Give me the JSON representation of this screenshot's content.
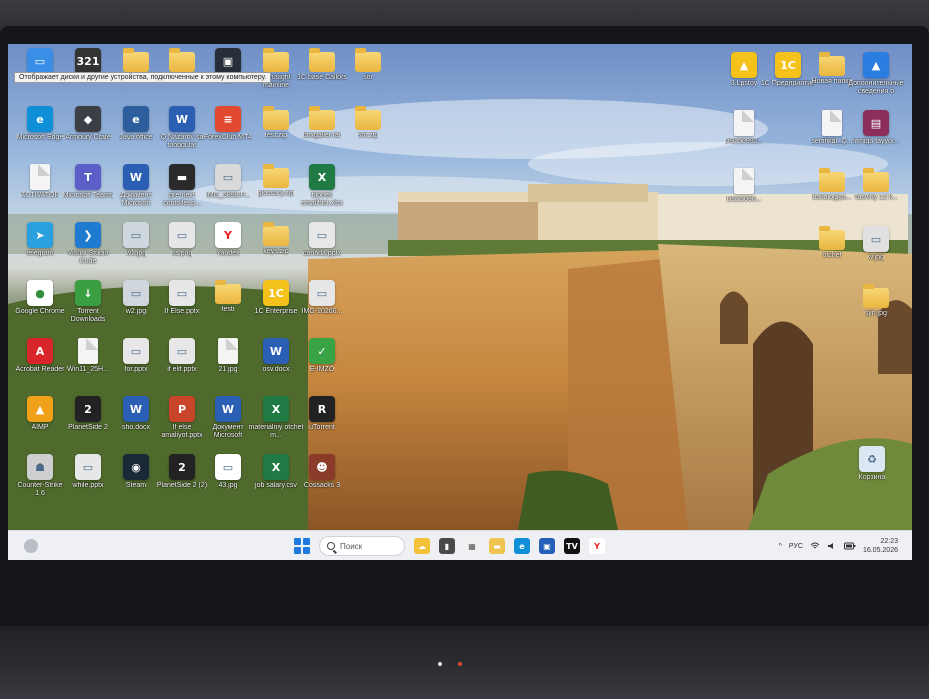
{
  "tooltip": {
    "text": "Отображает диски и другие устройства, подключенные к этому компьютеру."
  },
  "colors": {
    "accent": "#1f7ae0",
    "taskbar": "#eef0f3",
    "folder": "#f0c24f"
  },
  "desktop_icons": [
    {
      "label": "Этот компьютер",
      "icon": "monitor-icon",
      "bg": "#3a8ee6",
      "glyph": "▭"
    },
    {
      "label": "MPC-HC x64",
      "icon": "mpc-icon",
      "bg": "#333333",
      "glyph": "321"
    },
    {
      "label": "Home-mid",
      "icon": "folder-icon",
      "bg": "folder",
      "glyph": ""
    },
    {
      "label": "Pyrus",
      "icon": "folder-icon",
      "bg": "folder",
      "glyph": ""
    },
    {
      "label": "IMG_6032",
      "icon": "image-file-icon",
      "bg": "#27303a",
      "glyph": "▣"
    },
    {
      "label": "Pyrusight mainline",
      "icon": "folder-icon",
      "bg": "folder",
      "glyph": ""
    },
    {
      "label": "1C base Callors",
      "icon": "folder-icon",
      "bg": "folder",
      "glyph": ""
    },
    {
      "label": "sor",
      "icon": "folder-icon",
      "bg": "folder",
      "glyph": ""
    },
    {
      "label": "Microsoft Edge",
      "icon": "edge-icon",
      "bg": "#0f8fd8",
      "glyph": "e"
    },
    {
      "label": "Armoury Crate",
      "icon": "armoury-crate-icon",
      "bg": "#3b3f45",
      "glyph": "◆"
    },
    {
      "label": "Java office",
      "icon": "java-icon",
      "bg": "#2d5f9e",
      "glyph": "e"
    },
    {
      "label": "Q Nazarov sa toobgular",
      "icon": "word-doc-icon",
      "bg": "#2b5fb4",
      "glyph": "W"
    },
    {
      "label": "ForexClub MT4",
      "icon": "forex-icon",
      "bg": "#e2492f",
      "glyph": "≡"
    },
    {
      "label": "test.zip",
      "icon": "zip-folder-icon",
      "bg": "folder",
      "glyph": ""
    },
    {
      "label": "boxgaller.rar",
      "icon": "zip-folder-icon",
      "bg": "folder",
      "glyph": ""
    },
    {
      "label": "sor.zip",
      "icon": "zip-folder-icon",
      "bg": "folder",
      "glyph": ""
    },
    {
      "label": "ACTIVATOR",
      "icon": "file-icon",
      "bg": "file",
      "glyph": ""
    },
    {
      "label": "Microsoft Teams",
      "icon": "teams-icon",
      "bg": "#5b5fc7",
      "glyph": "T"
    },
    {
      "label": "Документ Microsoft",
      "icon": "word-doc-icon",
      "bg": "#2b5fb4",
      "glyph": "W"
    },
    {
      "label": "pre-next contoller.p...",
      "icon": "image-file-icon",
      "bg": "#2a2a2a",
      "glyph": "▬"
    },
    {
      "label": "IMG_5898.P...",
      "icon": "image-file-icon",
      "bg": "#d9d9d9",
      "glyph": "▭"
    },
    {
      "label": "glossary.zip",
      "icon": "zip-folder-icon",
      "bg": "folder",
      "glyph": ""
    },
    {
      "label": "biones emailhist.xlsx",
      "icon": "excel-icon",
      "bg": "#1f7a44",
      "glyph": "X"
    },
    {
      "label": "telegram",
      "icon": "telegram-icon",
      "bg": "#2aa1de",
      "glyph": "➤"
    },
    {
      "label": "Visual Studio Code",
      "icon": "vscode-icon",
      "bg": "#1e7bd0",
      "glyph": "❯"
    },
    {
      "label": "w1.jpg",
      "icon": "image-file-icon",
      "bg": "#cfd6dd",
      "glyph": "▭"
    },
    {
      "label": "ss.png",
      "icon": "image-file-icon",
      "bg": "#e6e6e6",
      "glyph": "▭"
    },
    {
      "label": "Yandex",
      "icon": "yandex-icon",
      "bg": "#ffffff",
      "glyph": "Y"
    },
    {
      "label": "keys.zip",
      "icon": "zip-folder-icon",
      "bg": "folder",
      "glyph": ""
    },
    {
      "label": "canada.pptx",
      "icon": "pptx-icon",
      "bg": "#e8e8e8",
      "glyph": "▭"
    },
    {
      "label": "Google Chrome",
      "icon": "chrome-icon",
      "bg": "#ffffff",
      "glyph": "●"
    },
    {
      "label": "Torrent Downloads",
      "icon": "torrent-icon",
      "bg": "#3a9e43",
      "glyph": "↓"
    },
    {
      "label": "w2.jpg",
      "icon": "image-file-icon",
      "bg": "#cfd6dd",
      "glyph": "▭"
    },
    {
      "label": "If Else.pptx",
      "icon": "pptx-icon",
      "bg": "#e7e7e7",
      "glyph": "▭"
    },
    {
      "label": "testi",
      "icon": "folder-icon",
      "bg": "folder",
      "glyph": ""
    },
    {
      "label": "1C Enterprise",
      "icon": "1c-icon",
      "bg": "#f4c21a",
      "glyph": "1С"
    },
    {
      "label": "IMG-20260...",
      "icon": "image-file-icon",
      "bg": "#e6e6e6",
      "glyph": "▭"
    },
    {
      "label": "Acrobat Reader",
      "icon": "acrobat-icon",
      "bg": "#d8252a",
      "glyph": "A"
    },
    {
      "label": "Win11_25H...",
      "icon": "file-icon",
      "bg": "file",
      "glyph": ""
    },
    {
      "label": "for.pptx",
      "icon": "pptx-icon",
      "bg": "#e7e7e7",
      "glyph": "▭"
    },
    {
      "label": "if elif.pptx",
      "icon": "pptx-icon",
      "bg": "#e7e7e7",
      "glyph": "▭"
    },
    {
      "label": "21.jpg",
      "icon": "file-icon",
      "bg": "file",
      "glyph": ""
    },
    {
      "label": "osv.docx",
      "icon": "word-doc-icon",
      "bg": "#2b5fb4",
      "glyph": "W"
    },
    {
      "label": "E-IMZO",
      "icon": "eimzo-icon",
      "bg": "#3aa345",
      "glyph": "✓"
    },
    {
      "label": "AIMP",
      "icon": "aimp-icon",
      "bg": "#f0a019",
      "glyph": "▲"
    },
    {
      "label": "PlanetSide 2",
      "icon": "planetside-icon",
      "bg": "#222222",
      "glyph": "2"
    },
    {
      "label": "sho.docx",
      "icon": "word-doc-icon",
      "bg": "#2b5fb4",
      "glyph": "W"
    },
    {
      "label": "If else amaliyot.pptx",
      "icon": "pptx-icon",
      "bg": "#c8452b",
      "glyph": "P"
    },
    {
      "label": "Документ Microsoft",
      "icon": "word-doc-icon",
      "bg": "#2b5fb4",
      "glyph": "W"
    },
    {
      "label": "materialniy otchet m...",
      "icon": "excel-icon",
      "bg": "#1f7a44",
      "glyph": "X"
    },
    {
      "label": "uTorrent",
      "icon": "utorrent-icon",
      "bg": "#222222",
      "glyph": "R"
    },
    {
      "label": "Counter-Strike 1.6",
      "icon": "cs-icon",
      "bg": "#cfcfcf",
      "glyph": "☗"
    },
    {
      "label": "while.pptx",
      "icon": "pptx-icon",
      "bg": "#e7e7e7",
      "glyph": "▭"
    },
    {
      "label": "Steam",
      "icon": "steam-icon",
      "bg": "#1b2838",
      "glyph": "◉"
    },
    {
      "label": "PlanetSide 2 (2)",
      "icon": "planetside-icon",
      "bg": "#222222",
      "glyph": "2"
    },
    {
      "label": "43.jpg",
      "icon": "image-file-icon",
      "bg": "#ffffff",
      "glyph": "▭"
    },
    {
      "label": "job salary.csv",
      "icon": "excel-icon",
      "bg": "#1f7a44",
      "glyph": "X"
    },
    {
      "label": "Cossacks 3",
      "icon": "cossacks-icon",
      "bg": "#8a3b2a",
      "glyph": "☻"
    },
    {
      "label": "3.Lpstoy",
      "icon": "1c-shortcut-icon",
      "bg": "#f4c21a",
      "glyph": "▲"
    },
    {
      "label": "1С Предприятие",
      "icon": "1c-icon",
      "bg": "#f4c21a",
      "glyph": "1С"
    },
    {
      "label": "Новая папка",
      "icon": "folder-icon",
      "bg": "folder",
      "glyph": ""
    },
    {
      "label": "Дополнительные сведения о",
      "icon": "photos-icon",
      "bg": "#2a7de1",
      "glyph": "▲"
    },
    {
      "label": "DS250592...",
      "icon": "file-icon",
      "bg": "file",
      "glyph": ""
    },
    {
      "label": "sertifikat_Q...",
      "icon": "file-icon",
      "bg": "file",
      "glyph": ""
    },
    {
      "label": "ntmiga tayyor...",
      "icon": "winrar-icon",
      "bg": "#8c2e5c",
      "glyph": "▤"
    },
    {
      "label": "DS25090...",
      "icon": "file-icon",
      "bg": "file",
      "glyph": ""
    },
    {
      "label": "bakalogiya...",
      "icon": "folder-icon",
      "bg": "folder",
      "glyph": ""
    },
    {
      "label": "Tasviriy 12 k...",
      "icon": "folder-icon",
      "bg": "folder",
      "glyph": ""
    },
    {
      "label": "otchet",
      "icon": "folder-icon",
      "bg": "folder",
      "glyph": ""
    },
    {
      "label": "w.jpg",
      "icon": "image-file-icon",
      "bg": "#e0e0e0",
      "glyph": "▭"
    },
    {
      "label": "sjin.jpg",
      "icon": "folder-icon",
      "bg": "folder",
      "glyph": ""
    },
    {
      "label": "Корзина",
      "icon": "recycle-bin-icon",
      "bg": "#dbe7f3",
      "glyph": "♻"
    }
  ],
  "taskbar": {
    "search_placeholder": "Поиск",
    "items": [
      {
        "name": "widgets-icon",
        "bg": "#f3c13a",
        "glyph": "☁"
      },
      {
        "name": "task-view-icon",
        "bg": "#4a4a4a",
        "glyph": "▮"
      },
      {
        "name": "calendar-icon",
        "bg": "#f2f2f2",
        "glyph": "▦"
      },
      {
        "name": "file-explorer-icon",
        "bg": "#f0c24f",
        "glyph": "▬"
      },
      {
        "name": "edge-icon",
        "bg": "#0f8fd8",
        "glyph": "e"
      },
      {
        "name": "store-icon",
        "bg": "#2460b8",
        "glyph": "▣"
      },
      {
        "name": "tradingview-icon",
        "bg": "#111111",
        "glyph": "TV"
      },
      {
        "name": "yandex-icon",
        "bg": "#ffffff",
        "glyph": "Y"
      }
    ],
    "tray": {
      "chevron": "^",
      "language": "РУС",
      "time": "22:23",
      "date": "16.05.2026"
    }
  }
}
